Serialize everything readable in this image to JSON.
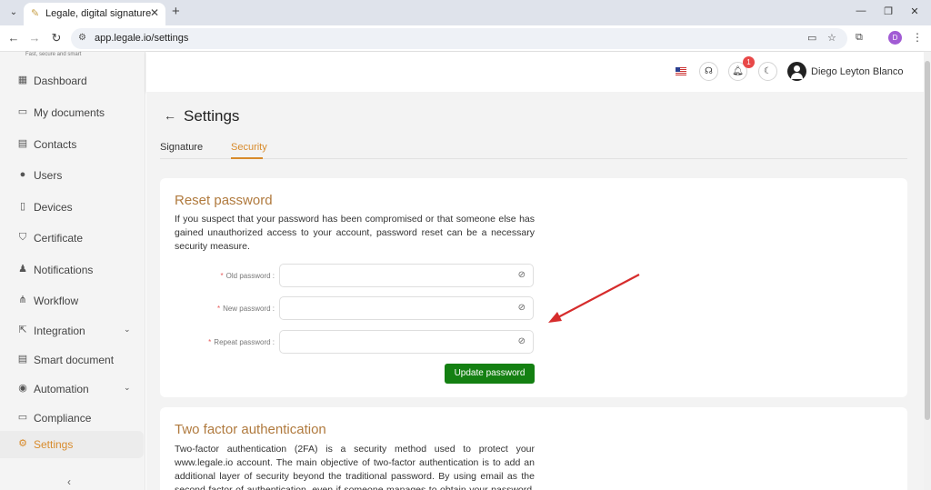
{
  "browser": {
    "tab_title": "Legale, digital signature",
    "url": "app.legale.io/settings",
    "profile_initial": "D",
    "tab_menu_glyph": "⌄",
    "tab_close_glyph": "✕",
    "new_tab_glyph": "+",
    "minimize_glyph": "—",
    "restore_glyph": "❐",
    "close_glyph": "✕",
    "back_glyph": "←",
    "forward_glyph": "→",
    "reload_glyph": "↻",
    "site_info_glyph": "⚙",
    "cast_glyph": "▭",
    "star_glyph": "☆",
    "extensions_glyph": "⧉",
    "menu_glyph": "⋮"
  },
  "sidebar": {
    "logo_tagline": "Fast, secure and smart",
    "items": [
      {
        "label": "Dashboard",
        "icon": "dashboard-icon",
        "glyph": "▦"
      },
      {
        "label": "My documents",
        "icon": "folder-icon",
        "glyph": "▭"
      },
      {
        "label": "Contacts",
        "icon": "contacts-icon",
        "glyph": "▤"
      },
      {
        "label": "Users",
        "icon": "user-icon",
        "glyph": "●"
      },
      {
        "label": "Devices",
        "icon": "device-icon",
        "glyph": "▯"
      },
      {
        "label": "Certificate",
        "icon": "shield-icon",
        "glyph": "⛉"
      },
      {
        "label": "Notifications",
        "icon": "bell-icon",
        "glyph": "♟"
      },
      {
        "label": "Workflow",
        "icon": "workflow-icon",
        "glyph": "⋔"
      },
      {
        "label": "Integration",
        "icon": "integration-icon",
        "glyph": "⇱"
      },
      {
        "label": "Smart document",
        "icon": "smart-document-icon",
        "glyph": "▤"
      },
      {
        "label": "Automation",
        "icon": "automation-icon",
        "glyph": "◉"
      },
      {
        "label": "Compliance",
        "icon": "compliance-icon",
        "glyph": "▭"
      },
      {
        "label": "Settings",
        "icon": "gear-icon",
        "glyph": "⚙"
      }
    ],
    "chevron_glyph": "⌄",
    "collapse_glyph": "‹",
    "active_item": "Settings"
  },
  "header": {
    "notification_count": "1",
    "user_name": "Diego Leyton Blanco",
    "support_glyph": "☊",
    "bell_glyph": "♫",
    "theme_glyph": "☾"
  },
  "page": {
    "back_glyph": "←",
    "title": "Settings",
    "tabs": [
      {
        "label": "Signature"
      },
      {
        "label": "Security"
      }
    ],
    "active_tab": "Security"
  },
  "reset_password": {
    "title": "Reset password",
    "description": "If you suspect that your password has been compromised or that someone else has gained unauthorized access to your account, password reset can be a necessary security measure.",
    "fields": [
      {
        "label": "Old password :",
        "value": ""
      },
      {
        "label": "New password :",
        "value": ""
      },
      {
        "label": "Repeat password :",
        "value": ""
      }
    ],
    "required_mark": "*",
    "eye_glyph": "⊘",
    "button_label": "Update password"
  },
  "two_factor": {
    "title": "Two factor authentication",
    "description": "Two-factor authentication (2FA) is a security method used to protect your www.legale.io account. The main objective of two-factor authentication is to add an additional layer of security beyond the traditional password. By using email as the second factor of authentication, even if someone manages to obtain your password, they won't be able to"
  },
  "colors": {
    "accent": "#d88b2c",
    "title_brown": "#b07a3e",
    "button_green": "#148012",
    "badge_red": "#e84848",
    "annotation_arrow": "#d62c2c"
  }
}
